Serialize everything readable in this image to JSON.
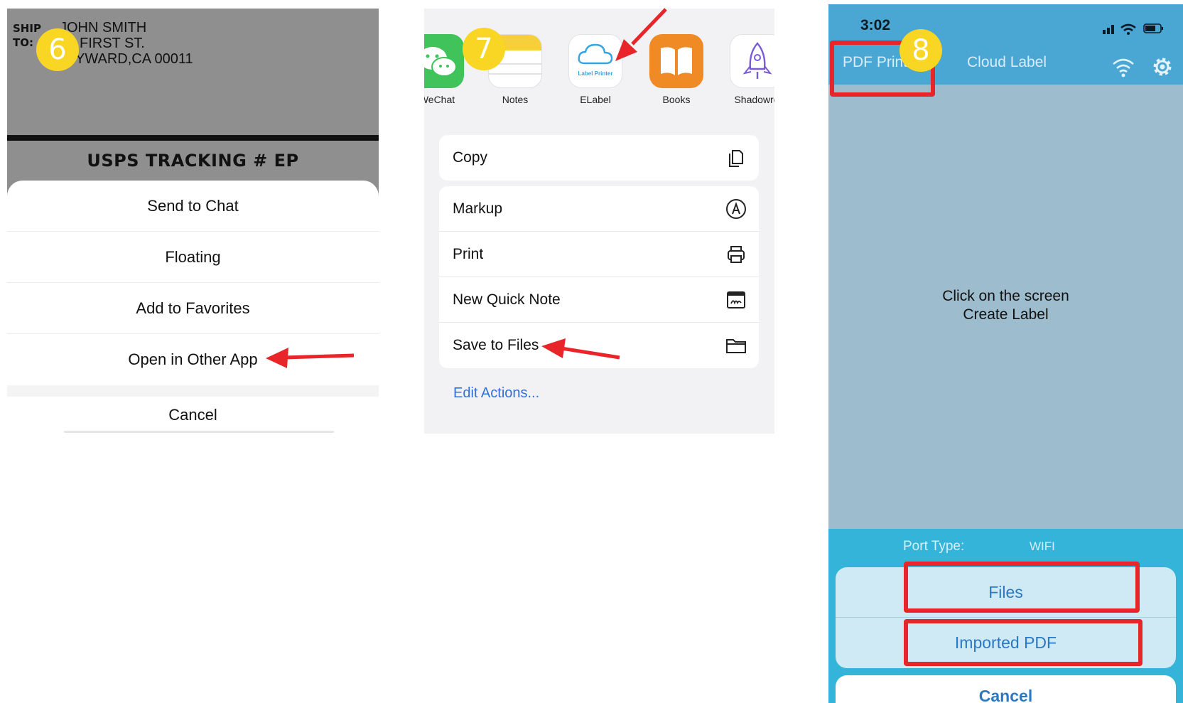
{
  "step6": {
    "badge": "6",
    "label": {
      "ship_to": [
        "SHIP",
        "TO:"
      ],
      "address_lines": [
        "JOHN SMITH",
        "FIRST ST.",
        "YWARD,CA 00011"
      ],
      "tracking": "USPS TRACKING # EP"
    },
    "menu": [
      "Send to Chat",
      "Floating",
      "Add to Favorites",
      "Open in Other App"
    ],
    "cancel": "Cancel"
  },
  "step7": {
    "badge": "7",
    "apps": [
      {
        "name": "WeChat",
        "icon": "wechat-icon"
      },
      {
        "name": "Notes",
        "icon": "notes-icon"
      },
      {
        "name": "ELabel",
        "icon": "elabel-icon",
        "icon_caption": "Label Printer"
      },
      {
        "name": "Books",
        "icon": "books-icon"
      },
      {
        "name": "Shadowro",
        "icon": "shadowrocket-icon"
      }
    ],
    "actions_primary": [
      {
        "label": "Copy",
        "icon": "copy-icon"
      }
    ],
    "actions": [
      {
        "label": "Markup",
        "icon": "markup-icon"
      },
      {
        "label": "Print",
        "icon": "printer-icon"
      },
      {
        "label": "New Quick Note",
        "icon": "quick-note-icon"
      },
      {
        "label": "Save to Files",
        "icon": "folder-icon"
      }
    ],
    "edit_actions": "Edit Actions..."
  },
  "step8": {
    "badge": "8",
    "status": {
      "time": "3:02"
    },
    "nav": {
      "pdf_print": "PDF Print",
      "cloud_label": "Cloud Label"
    },
    "main_message": [
      "Click on the screen",
      "Create Label"
    ],
    "port": {
      "label": "Port Type:",
      "value": "WIFI"
    },
    "options": [
      "Files",
      "Imported PDF"
    ],
    "cancel": "Cancel"
  },
  "colors": {
    "badge": "#f8d623",
    "highlight": "#e8262a",
    "ios_link": "#2f6fd6",
    "app_nav": "#4aa6d2",
    "app_sheet": "#35b4d9"
  }
}
